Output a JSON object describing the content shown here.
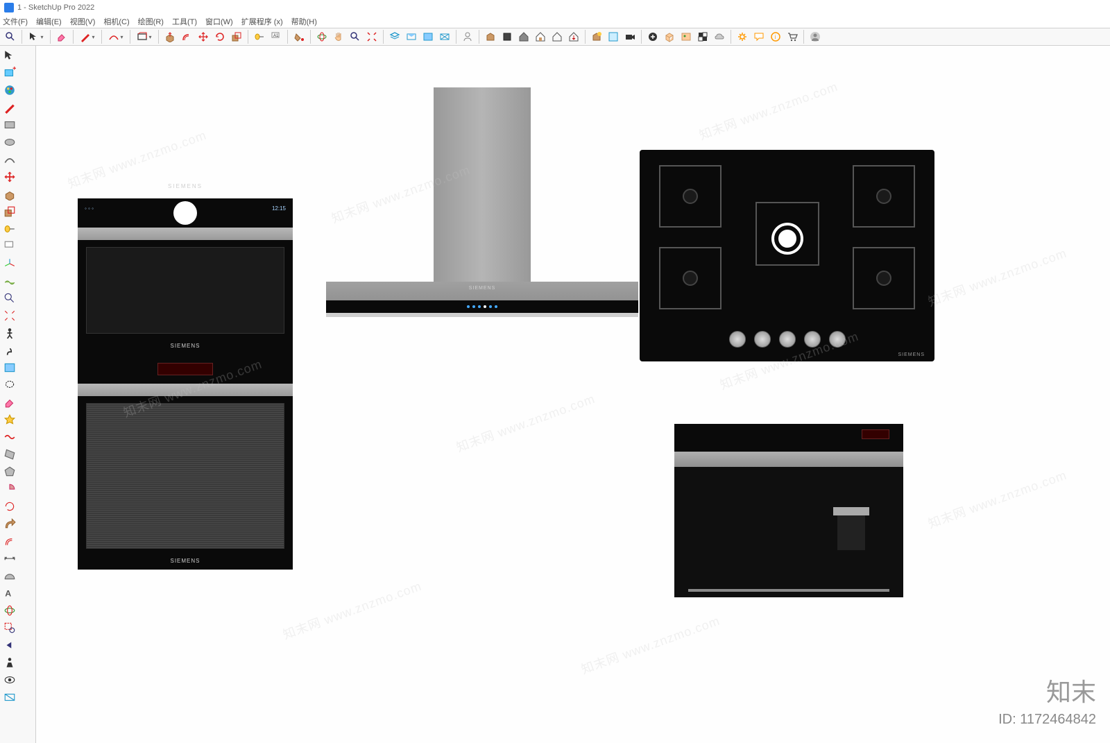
{
  "title": "1 - SketchUp Pro 2022",
  "menu": [
    "文件(F)",
    "编辑(E)",
    "视图(V)",
    "相机(C)",
    "绘图(R)",
    "工具(T)",
    "窗口(W)",
    "扩展程序 (x)",
    "帮助(H)"
  ],
  "brand": "SIEMENS",
  "oven_time": "12:15",
  "hood_brand": "SIEMENS",
  "cooktop_brand": "SIEMENS",
  "watermark": {
    "site": "知末",
    "url": "www.znzmo.com",
    "id_label": "ID:",
    "id": "1172464842",
    "combined": "知末网 www.znzmo.com"
  }
}
